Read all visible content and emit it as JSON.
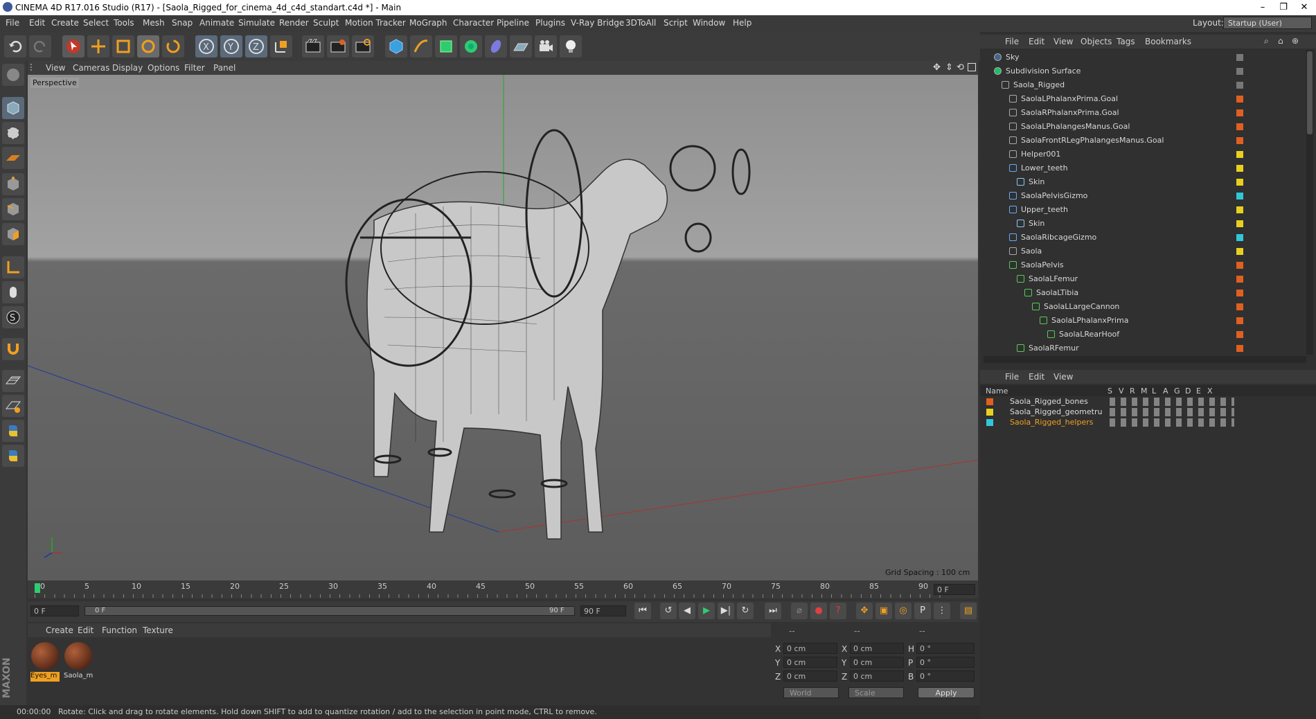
{
  "window": {
    "title": "CINEMA 4D R17.016 Studio (R17) - [Saola_Rigged_for_cinema_4d_c4d_standart.c4d *] - Main"
  },
  "menubar": {
    "items": [
      "File",
      "Edit",
      "Create",
      "Select",
      "Tools",
      "Mesh",
      "Snap",
      "Animate",
      "Simulate",
      "Render",
      "Sculpt",
      "Motion Tracker",
      "MoGraph",
      "Character",
      "Pipeline",
      "Plugins",
      "V-Ray Bridge",
      "3DToAll",
      "Script",
      "Window",
      "Help"
    ],
    "layout_label": "Layout:",
    "layout_value": "Startup (User)"
  },
  "viewport": {
    "menu": [
      "View",
      "Cameras",
      "Display",
      "Options",
      "Filter",
      "Panel"
    ],
    "label": "Perspective",
    "grid_spacing": "Grid Spacing : 100 cm"
  },
  "timeline": {
    "ticks": [
      "0",
      "5",
      "10",
      "15",
      "20",
      "25",
      "30",
      "35",
      "40",
      "45",
      "50",
      "55",
      "60",
      "65",
      "70",
      "75",
      "80",
      "85",
      "90"
    ],
    "current_frame": "0 F",
    "start_field": "0 F",
    "range_start": "0 F",
    "range_end": "90 F",
    "end_field": "90 F"
  },
  "materials": {
    "menu": [
      "Create",
      "Edit",
      "Function",
      "Texture"
    ],
    "items": [
      {
        "name": "Eyes_m"
      },
      {
        "name": "Saola_m"
      }
    ]
  },
  "coords": {
    "header": [
      "--",
      "--",
      "--"
    ],
    "rows": [
      {
        "a": "X",
        "av": "0 cm",
        "b": "X",
        "bv": "0 cm",
        "c": "H",
        "cv": "0 °"
      },
      {
        "a": "Y",
        "av": "0 cm",
        "b": "Y",
        "bv": "0 cm",
        "c": "P",
        "cv": "0 °"
      },
      {
        "a": "Z",
        "av": "0 cm",
        "b": "Z",
        "bv": "0 cm",
        "c": "B",
        "cv": "0 °"
      }
    ],
    "world": "World",
    "scale": "Scale",
    "apply": "Apply"
  },
  "status": {
    "time": "00:00:00",
    "text": "Rotate: Click and drag to rotate elements. Hold down SHIFT to add to quantize rotation / add to the selection in point mode, CTRL to remove."
  },
  "object_manager": {
    "menu": [
      "File",
      "Edit",
      "View",
      "Objects",
      "Tags",
      "Bookmarks"
    ],
    "rows": [
      {
        "name": "Sky",
        "indent": 0,
        "color": "#777777"
      },
      {
        "name": "Subdivision Surface",
        "indent": 0,
        "color": "#777777"
      },
      {
        "name": "Saola_Rigged",
        "indent": 1,
        "color": "#777777"
      },
      {
        "name": "SaolaLPhalanxPrima.Goal",
        "indent": 2,
        "color": "#e06020"
      },
      {
        "name": "SaolaRPhalanxPrima.Goal",
        "indent": 2,
        "color": "#e06020"
      },
      {
        "name": "SaolaLPhalangesManus.Goal",
        "indent": 2,
        "color": "#e06020"
      },
      {
        "name": "SaolaFrontRLegPhalangesManus.Goal",
        "indent": 2,
        "color": "#e06020"
      },
      {
        "name": "Helper001",
        "indent": 2,
        "color": "#e8d020"
      },
      {
        "name": "Lower_teeth",
        "indent": 2,
        "color": "#e8d020"
      },
      {
        "name": "Skin",
        "indent": 3,
        "color": "#e8d020"
      },
      {
        "name": "SaolaPelvisGizmo",
        "indent": 2,
        "color": "#30c8d8"
      },
      {
        "name": "Upper_teeth",
        "indent": 2,
        "color": "#e8d020"
      },
      {
        "name": "Skin",
        "indent": 3,
        "color": "#e8d020"
      },
      {
        "name": "SaolaRibcageGizmo",
        "indent": 2,
        "color": "#30c8d8"
      },
      {
        "name": "Saola",
        "indent": 2,
        "color": "#e8d020"
      },
      {
        "name": "SaolaPelvis",
        "indent": 2,
        "color": "#e06020"
      },
      {
        "name": "SaolaLFemur",
        "indent": 3,
        "color": "#e06020"
      },
      {
        "name": "SaolaLTibia",
        "indent": 4,
        "color": "#e06020"
      },
      {
        "name": "SaolaLLargeCannon",
        "indent": 5,
        "color": "#e06020"
      },
      {
        "name": "SaolaLPhalanxPrima",
        "indent": 6,
        "color": "#e06020"
      },
      {
        "name": "SaolaLRearHoof",
        "indent": 7,
        "color": "#e06020"
      },
      {
        "name": "SaolaRFemur",
        "indent": 3,
        "color": "#e06020"
      }
    ]
  },
  "layer_manager": {
    "menu": [
      "File",
      "Edit",
      "View"
    ],
    "columns": [
      "Name",
      "S",
      "V",
      "R",
      "M",
      "L",
      "A",
      "G",
      "D",
      "E",
      "X"
    ],
    "layers": [
      {
        "name": "Saola_Rigged_bones",
        "color": "#e06020",
        "selected": false
      },
      {
        "name": "Saola_Rigged_geometru",
        "color": "#e8d020",
        "selected": false
      },
      {
        "name": "Saola_Rigged_helpers",
        "color": "#30c8d8",
        "selected": true
      }
    ]
  },
  "colors": {
    "accent": "#f0a020",
    "selected_text": "#f0a020"
  }
}
